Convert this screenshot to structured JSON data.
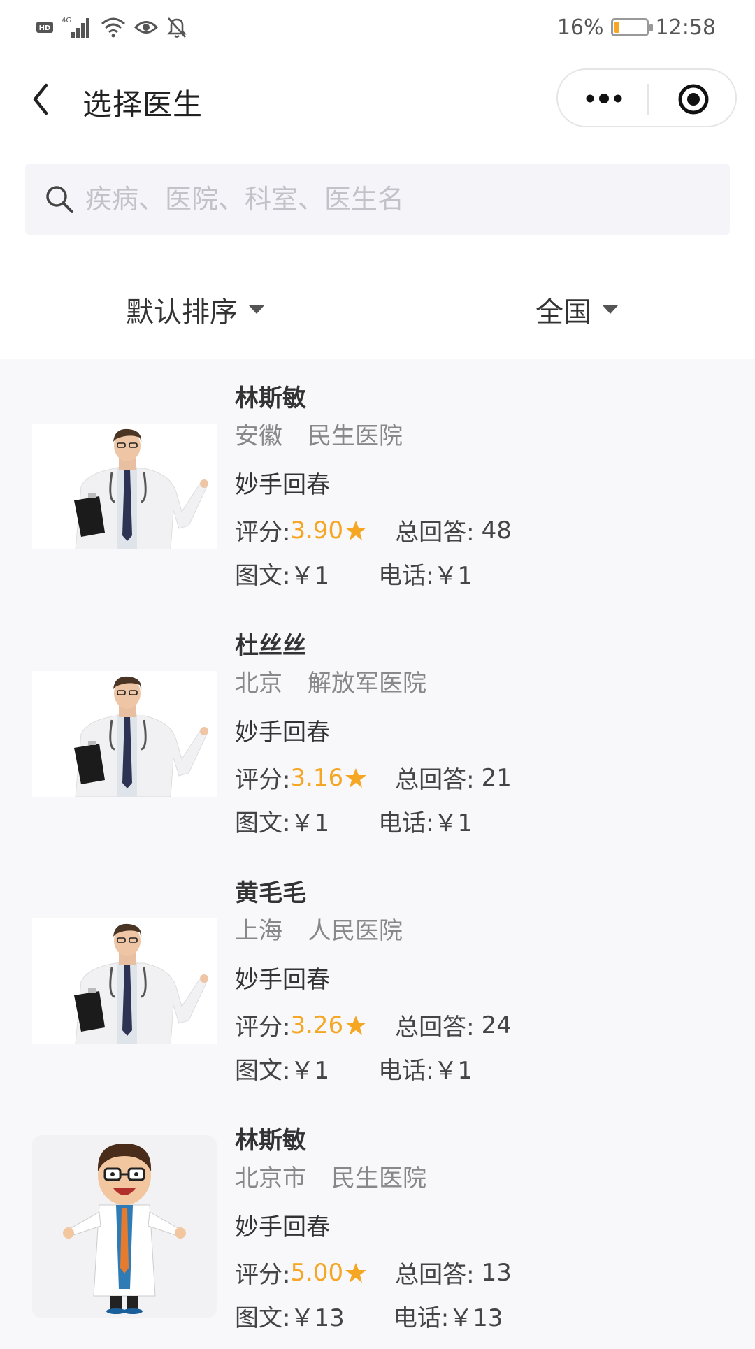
{
  "status_bar": {
    "left_icons": [
      "hd-icon",
      "4g-signal-icon",
      "wifi-icon",
      "eye-icon",
      "bell-off-icon"
    ],
    "network_label": "4G",
    "battery_percent": "16%",
    "battery_level": 0.16,
    "battery_color": "#f5a623",
    "time": "12:58"
  },
  "nav": {
    "title": "选择医生"
  },
  "search": {
    "placeholder": "疾病、医院、科室、医生名"
  },
  "filters": {
    "sort_label": "默认排序",
    "region_label": "全国"
  },
  "accent_color": "#f5a623",
  "doctors": [
    {
      "name": "林斯敏",
      "province": "安徽",
      "hospital": "民生医院",
      "skill": "妙手回春",
      "score_label": "评分:",
      "score": "3.90",
      "answers_label": "总回答:",
      "answers": "48",
      "text_price": "图文:￥1",
      "phone_price": "电话:￥1",
      "avatar": "photo"
    },
    {
      "name": "杜丝丝",
      "province": "北京",
      "hospital": "解放军医院",
      "skill": "妙手回春",
      "score_label": "评分:",
      "score": "3.16",
      "answers_label": "总回答:",
      "answers": "21",
      "text_price": "图文:￥1",
      "phone_price": "电话:￥1",
      "avatar": "photo"
    },
    {
      "name": "黄毛毛",
      "province": "上海",
      "hospital": "人民医院",
      "skill": "妙手回春",
      "score_label": "评分:",
      "score": "3.26",
      "answers_label": "总回答:",
      "answers": "24",
      "text_price": "图文:￥1",
      "phone_price": "电话:￥1",
      "avatar": "photo"
    },
    {
      "name": "林斯敏",
      "province": "北京市",
      "hospital": "民生医院",
      "skill": "妙手回春",
      "score_label": "评分:",
      "score": "5.00",
      "answers_label": "总回答:",
      "answers": "13",
      "text_price": "图文:￥13",
      "phone_price": "电话:￥13",
      "avatar": "cartoon"
    }
  ]
}
